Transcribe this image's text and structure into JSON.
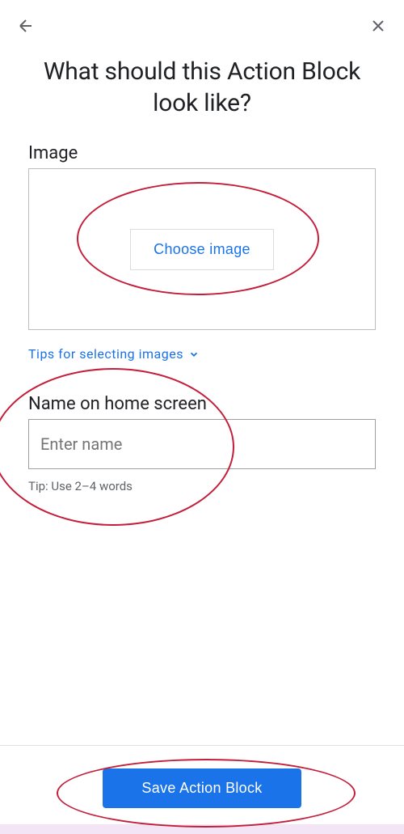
{
  "header": {
    "back_icon": "back",
    "close_icon": "close"
  },
  "title": "What should this Action Block look like?",
  "image_section": {
    "label": "Image",
    "choose_button": "Choose image",
    "tips_link": "Tips for selecting images"
  },
  "name_section": {
    "label": "Name on home screen",
    "placeholder": "Enter name",
    "tip": "Tip: Use 2–4 words"
  },
  "footer": {
    "save_button": "Save Action Block"
  }
}
